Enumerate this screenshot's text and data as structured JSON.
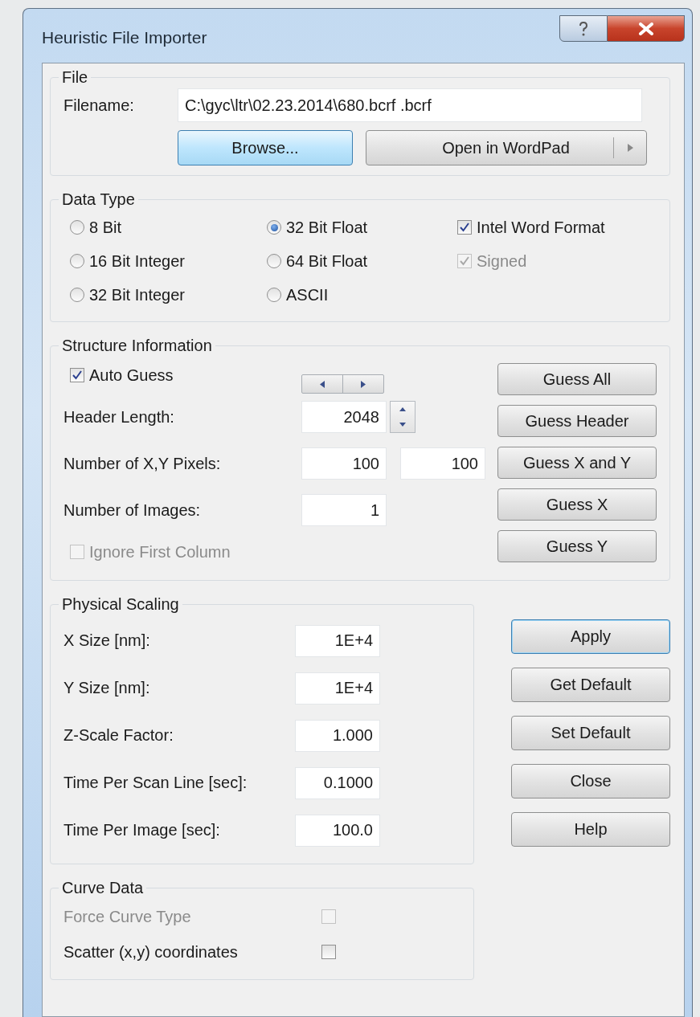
{
  "window": {
    "title": "Heuristic File Importer"
  },
  "file": {
    "title": "File",
    "filename_label": "Filename:",
    "filename": "C:\\gyc\\ltr\\02.23.2014\\680.bcrf .bcrf",
    "browse_button": {
      "label": "Browse...",
      "hot": true
    },
    "open_button": {
      "label": "Open in WordPad"
    }
  },
  "data_type": {
    "title": "Data Type",
    "options": [
      {
        "kind": "radio",
        "label": "8 Bit",
        "selected": false
      },
      {
        "kind": "radio",
        "label": "32 Bit Float",
        "selected": true
      },
      {
        "kind": "checkbox",
        "label": "Intel Word Format",
        "checked": true,
        "disabled": false
      },
      {
        "kind": "radio",
        "label": "16 Bit Integer",
        "selected": false
      },
      {
        "kind": "radio",
        "label": "64 Bit Float",
        "selected": false
      },
      {
        "kind": "checkbox",
        "label": "Signed",
        "checked": true,
        "disabled": true
      },
      {
        "kind": "radio",
        "label": "32 Bit Integer",
        "selected": false
      },
      {
        "kind": "radio",
        "label": "ASCII",
        "selected": false
      }
    ]
  },
  "structure": {
    "title": "Structure Information",
    "auto_guess": {
      "label": "Auto Guess",
      "checked": true
    },
    "fields": [
      {
        "kind": "spinner",
        "label": "Header Length:",
        "values": [
          "2048"
        ]
      },
      {
        "kind": "plain",
        "label": "Number of X,Y Pixels:",
        "values": [
          "100",
          "100"
        ]
      },
      {
        "kind": "plain",
        "label": "Number of Images:",
        "values": [
          "1"
        ]
      }
    ],
    "ignore_first_column": {
      "label": "Ignore First Column",
      "checked": false,
      "disabled": true
    },
    "buttons": [
      "Guess All",
      "Guess Header",
      "Guess X and Y",
      "Guess X",
      "Guess Y"
    ]
  },
  "physical_scaling": {
    "title": "Physical Scaling",
    "fields": [
      {
        "label": "X Size [nm]:",
        "value": "1E+4"
      },
      {
        "label": "Y Size [nm]:",
        "value": "1E+4"
      },
      {
        "label": "Z-Scale Factor:",
        "value": "1.000"
      },
      {
        "label": "Time Per Scan Line [sec]:",
        "value": "0.1000"
      },
      {
        "label": "Time Per Image [sec]:",
        "value": "100.0"
      }
    ]
  },
  "actions": [
    {
      "label": "Apply",
      "default": true
    },
    {
      "label": "Get Default",
      "default": false
    },
    {
      "label": "Set Default",
      "default": false
    },
    {
      "label": "Close",
      "default": false
    },
    {
      "label": "Help",
      "default": false
    }
  ],
  "curve_data": {
    "title": "Curve Data",
    "options": [
      {
        "label": "Force Curve Type",
        "checked": false,
        "disabled": true
      },
      {
        "label": "Scatter (x,y) coordinates",
        "checked": false,
        "disabled": false
      }
    ]
  }
}
